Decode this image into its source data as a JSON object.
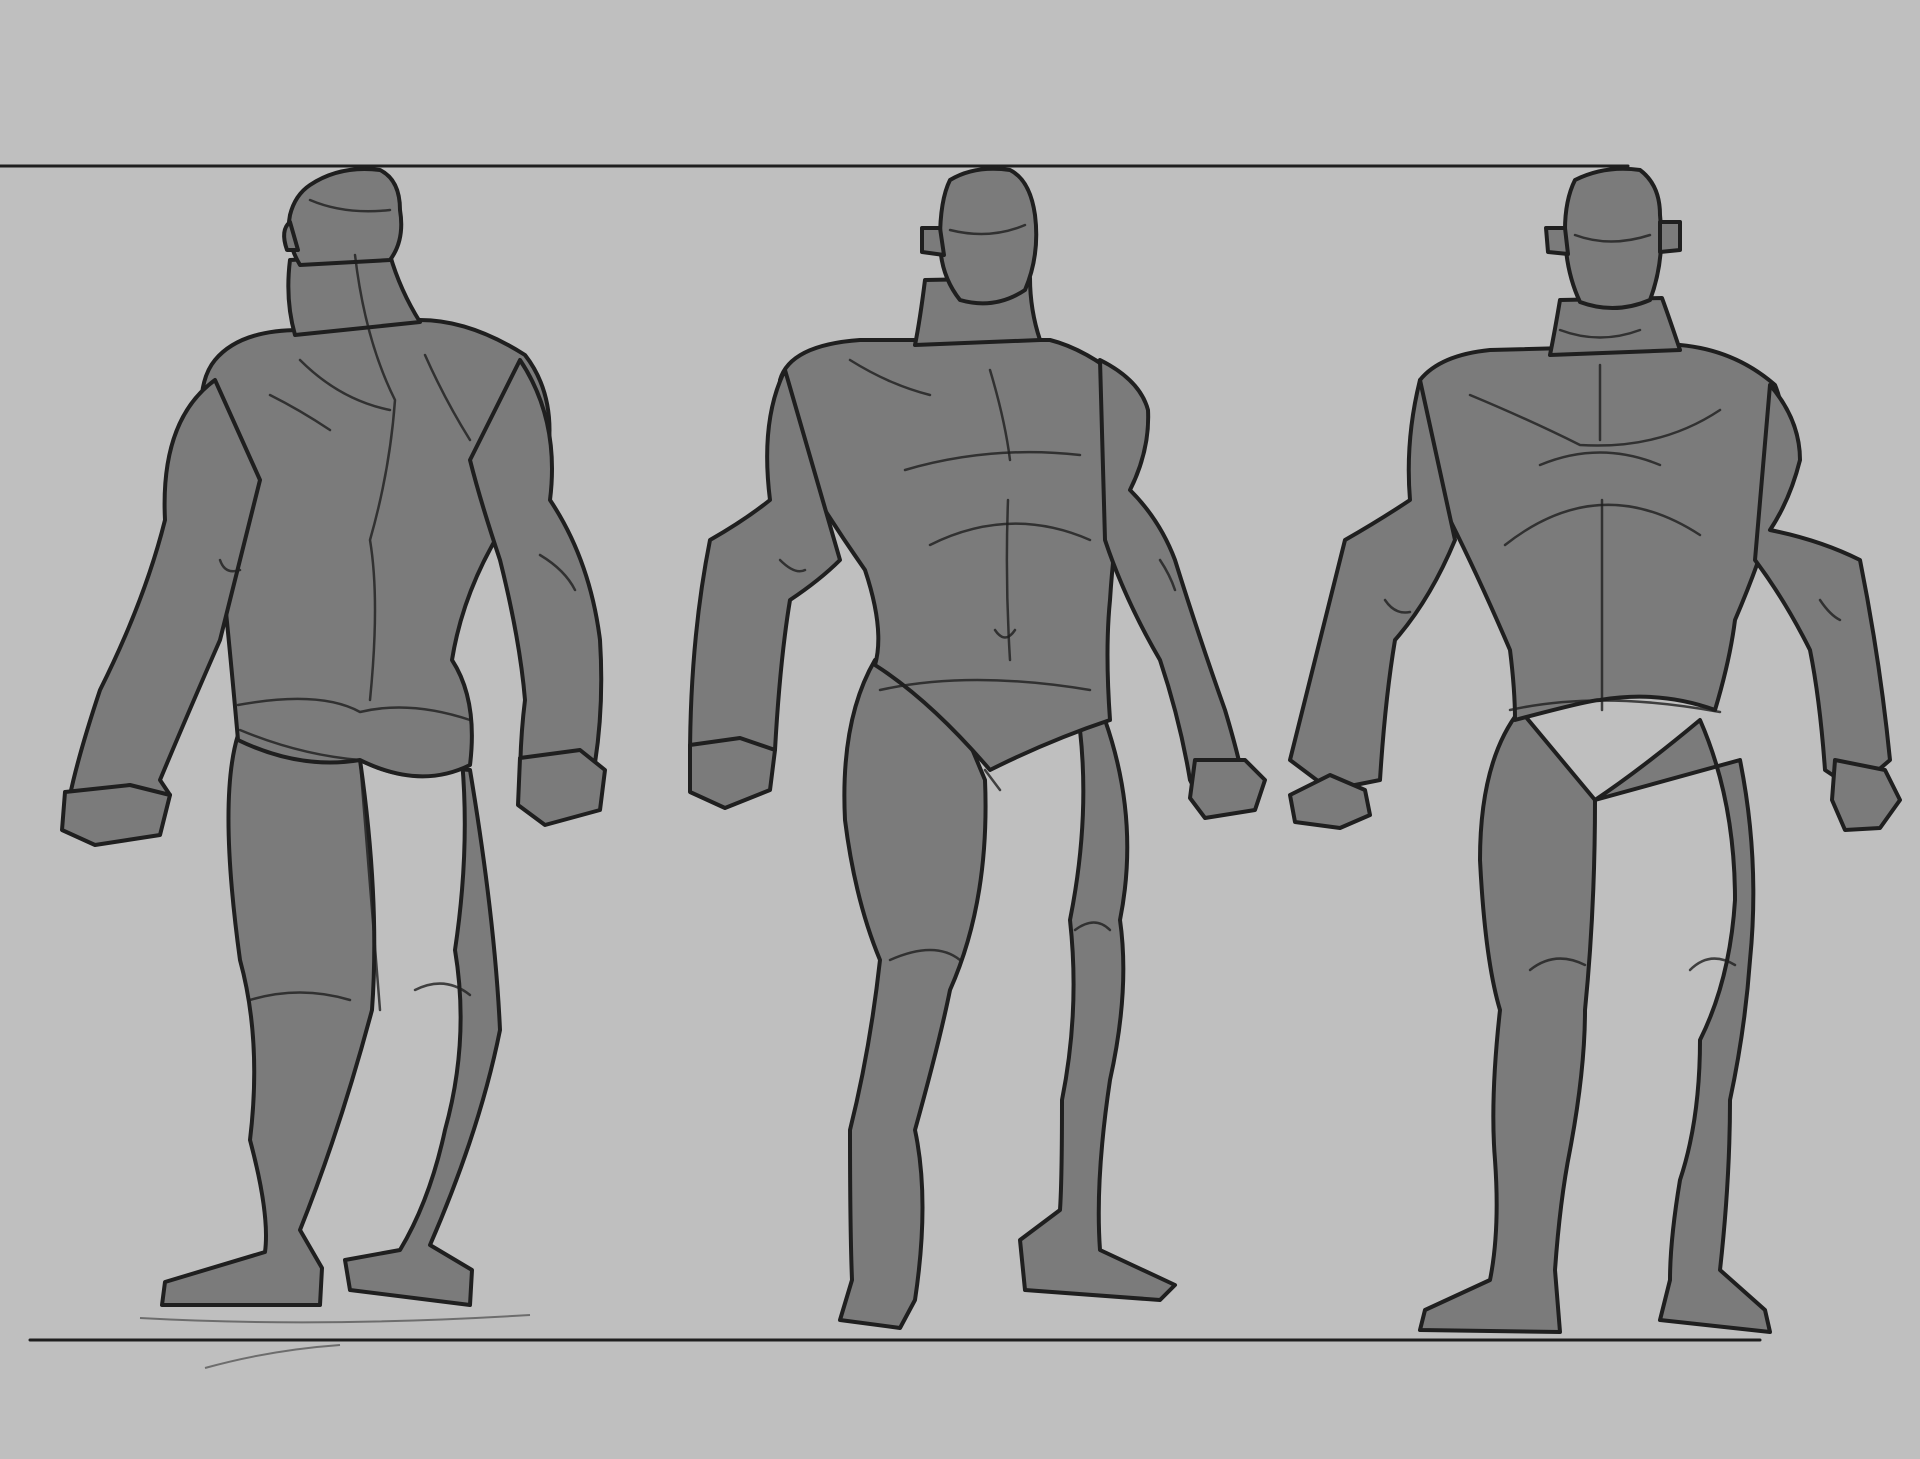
{
  "canvas": {
    "background": "#bfbfbf",
    "figure_fill": "#7b7b7b",
    "line_color": "#1f1f1f"
  },
  "views": [
    {
      "name": "back-view"
    },
    {
      "name": "three-quarter-view"
    },
    {
      "name": "front-view"
    }
  ]
}
